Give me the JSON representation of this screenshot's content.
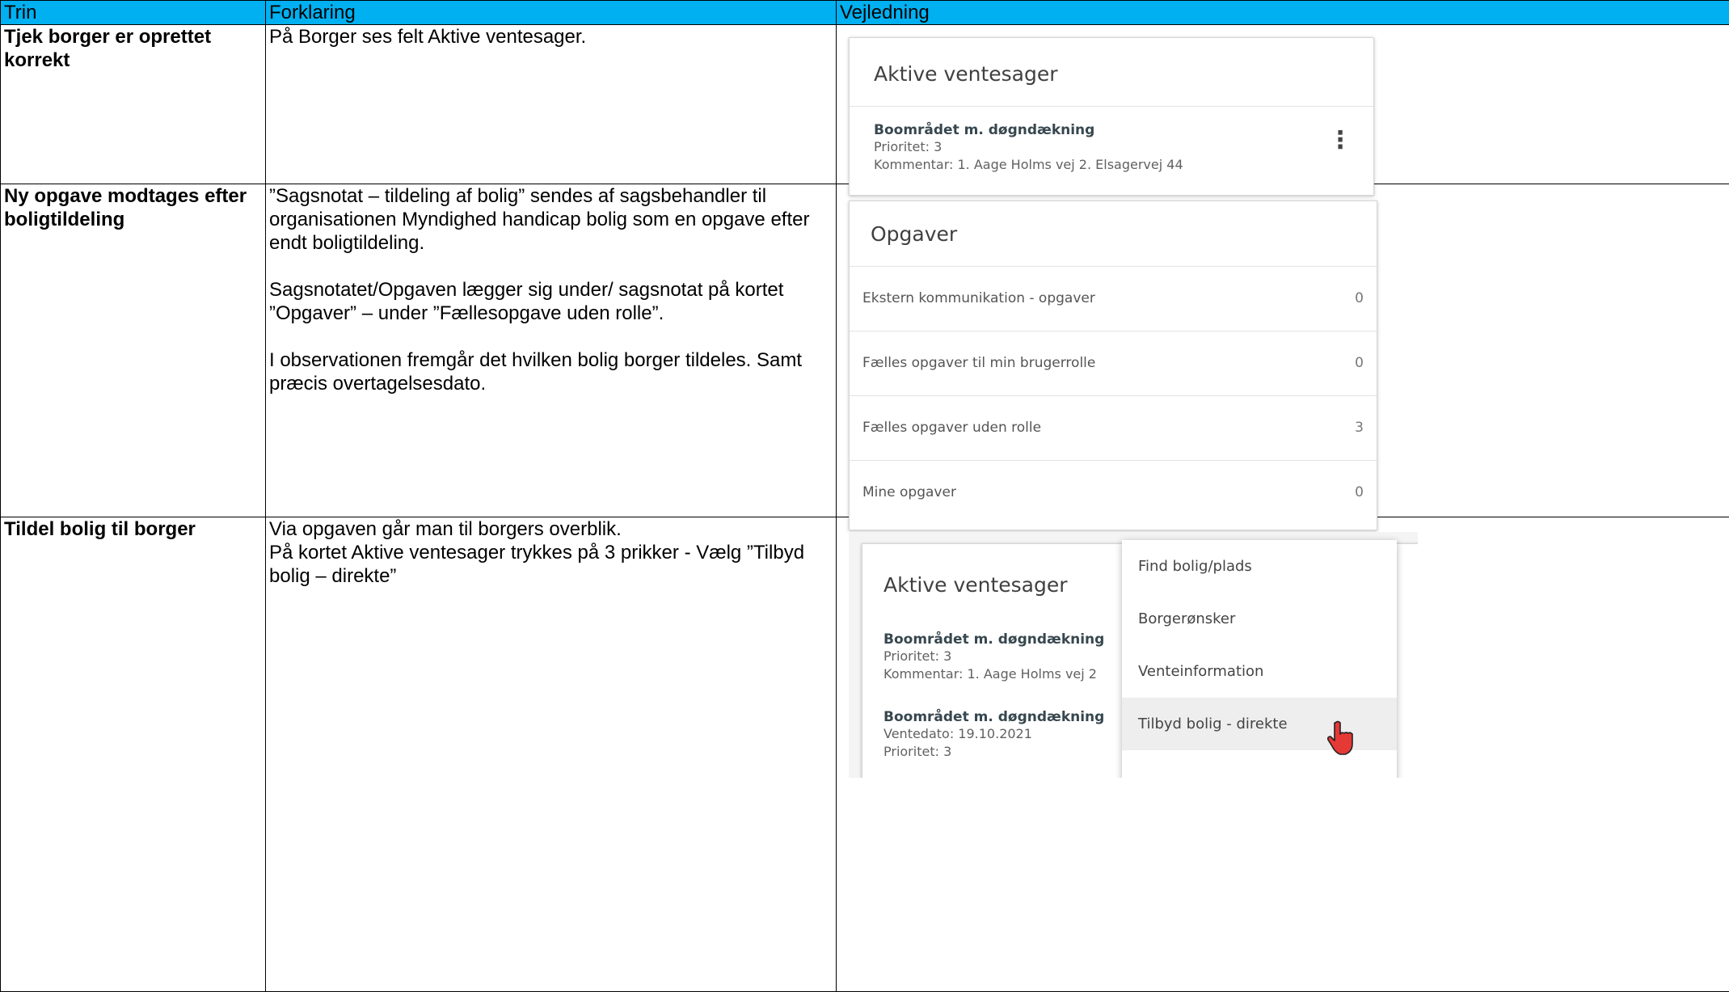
{
  "table": {
    "headers": [
      "Trin",
      "Forklaring",
      "Vejledning"
    ],
    "rows": [
      {
        "trin": "Tjek borger er oprettet korrekt",
        "forklaring": [
          "På Borger ses felt Aktive ventesager."
        ]
      },
      {
        "trin": "Ny opgave modtages efter boligtildeling",
        "forklaring": [
          "”Sagsnotat – tildeling af bolig” sendes af sagsbehandler til organisationen Myndighed handicap bolig som en opgave efter endt boligtildeling.",
          "Sagsnotatet/Opgaven lægger sig under/ sagsnotat på kortet ”Opgaver” – under ”Fællesopgave uden rolle”.",
          "I observationen fremgår det hvilken bolig borger tildeles. Samt præcis overtagelsesdato."
        ]
      },
      {
        "trin": "Tildel bolig til borger",
        "forklaring": [
          "Via opgaven går man til borgers overblik.",
          "På kortet Aktive ventesager trykkes på 3 prikker - Vælg ”Tilbyd bolig – direkte”"
        ]
      }
    ]
  },
  "shot1": {
    "title": "Aktive ventesager",
    "entry_title": "Boområdet m. døgndækning",
    "entry_line1": "Prioritet: 3",
    "entry_line2": "Kommentar: 1. Aage Holms vej 2. Elsagervej 44",
    "menu_icon": "kebab-icon"
  },
  "shot2": {
    "title": "Opgaver",
    "rows": [
      {
        "label": "Ekstern kommunikation - opgaver",
        "count": "0"
      },
      {
        "label": "Fælles opgaver til min brugerrolle",
        "count": "0"
      },
      {
        "label": "Fælles opgaver uden rolle",
        "count": "3"
      },
      {
        "label": "Mine opgaver",
        "count": "0"
      }
    ]
  },
  "shot3": {
    "title": "Aktive ventesager",
    "entry1_title": "Boområdet m. døgndækning",
    "entry1_line1": "Prioritet: 3",
    "entry1_line2": "Kommentar: 1. Aage Holms vej 2",
    "entry2_title": "Boområdet m. døgndækning",
    "entry2_line1": "Ventedato: 19.10.2021",
    "entry2_line2": "Prioritet: 3",
    "menu": [
      "Find bolig/plads",
      "Borgerønsker",
      "Venteinformation",
      "Tilbyd bolig - direkte"
    ],
    "cursor_icon": "hand-pointer-icon",
    "colors": {
      "cursor": "#e53935"
    }
  },
  "colors": {
    "header_bg": "#00b0f0"
  }
}
